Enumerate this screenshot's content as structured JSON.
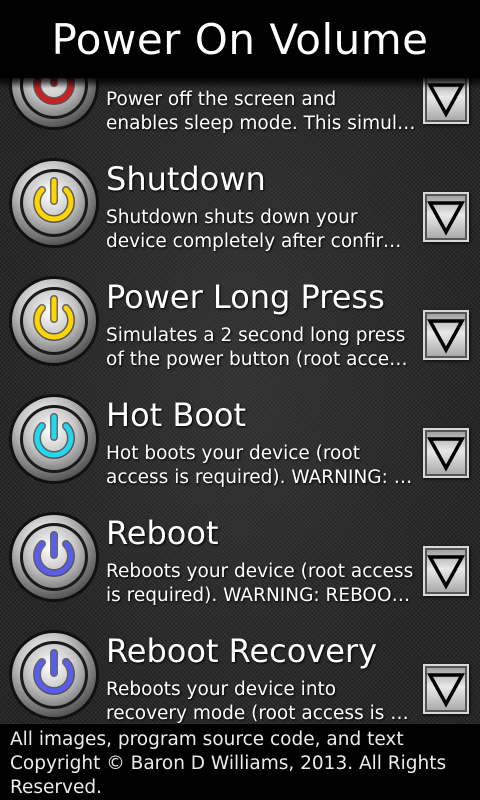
{
  "app": {
    "title": "Power On Volume"
  },
  "items": [
    {
      "id": "sleep",
      "title": "",
      "desc": [
        "Power off the screen and",
        "enables sleep mode. This simul…"
      ],
      "ring_color": "#cc2020",
      "icon": "power-icon"
    },
    {
      "id": "shutdown",
      "title": "Shutdown",
      "desc": [
        "Shutdown shuts down your",
        "device completely after confirm…"
      ],
      "ring_color": "#ffd400",
      "icon": "power-icon"
    },
    {
      "id": "power-long-press",
      "title": "Power Long Press",
      "desc": [
        "Simulates a 2 second long press",
        "of the power button (root acces…"
      ],
      "ring_color": "#ffd400",
      "icon": "power-icon"
    },
    {
      "id": "hot-boot",
      "title": "Hot Boot",
      "desc": [
        "Hot boots your device (root",
        "access is required). WARNING: …"
      ],
      "ring_color": "#22d8f0",
      "icon": "power-icon"
    },
    {
      "id": "reboot",
      "title": "Reboot",
      "desc": [
        "Reboots your device (root access",
        "is required). WARNING: REBOOT…"
      ],
      "ring_color": "#5a5cf0",
      "icon": "power-icon"
    },
    {
      "id": "reboot-recovery",
      "title": "Reboot Recovery",
      "desc": [
        "Reboots your device into",
        "recovery mode (root access is r…"
      ],
      "ring_color": "#5a5cf0",
      "icon": "power-icon"
    }
  ],
  "footer": {
    "text": "All images, program source code, and text Copyright © Baron D Williams, 2013. All Rights Reserved."
  }
}
